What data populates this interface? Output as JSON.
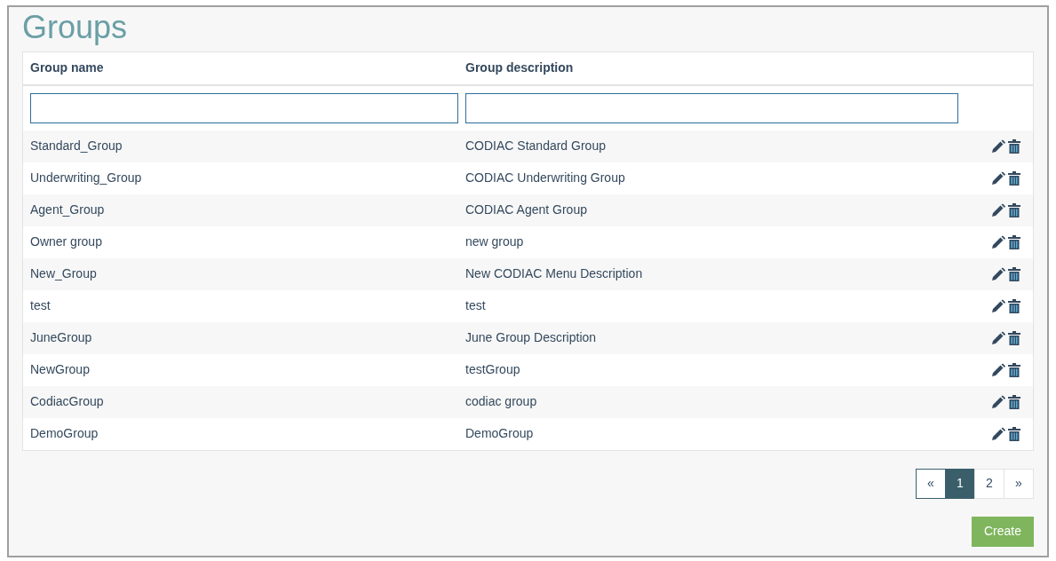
{
  "title": "Groups",
  "table": {
    "columns": [
      "Group name",
      "Group description"
    ],
    "rows": [
      {
        "name": "Standard_Group",
        "description": "CODIAC Standard Group"
      },
      {
        "name": "Underwriting_Group",
        "description": "CODIAC Underwriting Group"
      },
      {
        "name": "Agent_Group",
        "description": "CODIAC Agent Group"
      },
      {
        "name": "Owner group",
        "description": "new group"
      },
      {
        "name": "New_Group",
        "description": "New CODIAC Menu Description"
      },
      {
        "name": "test",
        "description": "test"
      },
      {
        "name": "JuneGroup",
        "description": "June Group Description"
      },
      {
        "name": "NewGroup",
        "description": "testGroup"
      },
      {
        "name": "CodiacGroup",
        "description": "codiac group"
      },
      {
        "name": "DemoGroup",
        "description": "DemoGroup"
      }
    ]
  },
  "pagination": [
    {
      "label": "«",
      "selected": false
    },
    {
      "label": "1",
      "selected": true
    },
    {
      "label": "2",
      "selected": false
    },
    {
      "label": "»",
      "selected": false
    }
  ],
  "create_button": "Create"
}
